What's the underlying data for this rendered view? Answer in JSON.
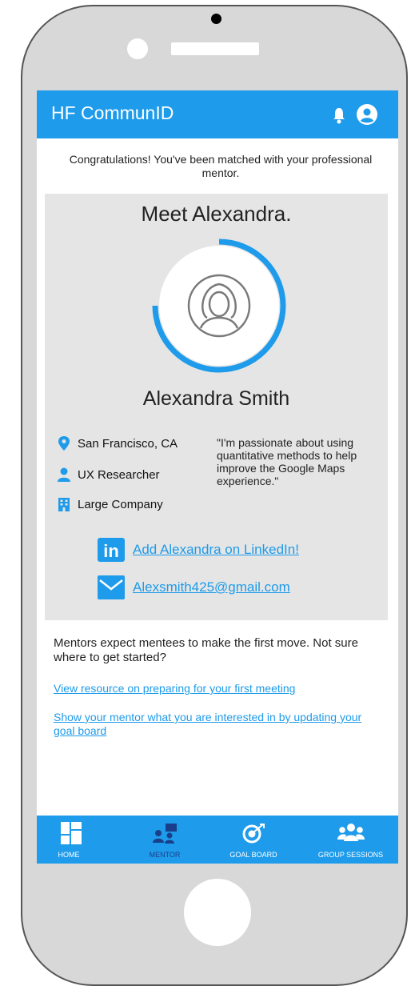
{
  "app": {
    "title": "HF CommunID"
  },
  "header": {
    "notification_icon": "bell-icon",
    "profile_icon": "user-circle-icon"
  },
  "congrats": "Congratulations! You've been matched with your professional mentor.",
  "mentor_card": {
    "heading": "Meet Alexandra.",
    "avatar_icon": "female-avatar-icon",
    "name": "Alexandra Smith",
    "location": "San Francisco, CA",
    "role": "UX Researcher",
    "company_size": "Large Company",
    "quote": "\"I'm passionate about using quantitative methods to help improve the Google Maps experience.\"",
    "linkedin_label": "Add Alexandra on LinkedIn!",
    "email": "Alexsmith425@gmail.com"
  },
  "guidance": {
    "text": "Mentors expect mentees to make the first move. Not sure where to get started?",
    "link_resource": "View resource on preparing for your first meeting",
    "link_goal_board": "Show your mentor what you are interested in by updating your goal board"
  },
  "tabs": [
    {
      "label": "HOME",
      "icon": "home-grid-icon",
      "active": false
    },
    {
      "label": "MENTOR",
      "icon": "mentor-icon",
      "active": true
    },
    {
      "label": "GOAL BOARD",
      "icon": "target-icon",
      "active": false
    },
    {
      "label": "GROUP SESSIONS",
      "icon": "group-icon",
      "active": false
    }
  ],
  "colors": {
    "accent": "#1e9bea",
    "active_tab": "#1a3f8a",
    "card_bg": "#e5e5e5"
  }
}
